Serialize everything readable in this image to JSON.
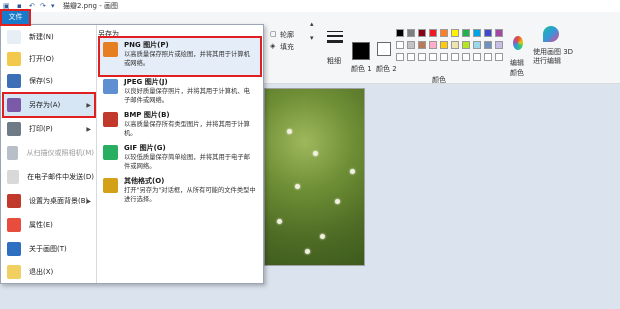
{
  "window": {
    "title": "猫瓣2.png - 画图"
  },
  "ribbon": {
    "file_tab": "文件",
    "outline_label": "轮廓",
    "fill_label": "填充",
    "thickness_label": "粗细",
    "color1_label": "颜色 1",
    "color2_label": "颜色 2",
    "edit_colors_label": "编辑颜色",
    "paint3d_label": "使用画图 3D 进行编辑",
    "colors_group_label": "颜色",
    "palette_row1": [
      "#000000",
      "#7f7f7f",
      "#880015",
      "#ed1c24",
      "#ff7f27",
      "#fff200",
      "#22b14c",
      "#00a2e8",
      "#3f48cc",
      "#a349a4"
    ],
    "palette_row2": [
      "#ffffff",
      "#c3c3c3",
      "#b97a57",
      "#ffaec9",
      "#ffc90e",
      "#efe4b0",
      "#b5e61d",
      "#99d9ea",
      "#7092be",
      "#c8bfe7"
    ],
    "palette_row3": [
      "#ffffff",
      "#ffffff",
      "#ffffff",
      "#ffffff",
      "#ffffff",
      "#ffffff",
      "#ffffff",
      "#ffffff",
      "#ffffff",
      "#ffffff"
    ]
  },
  "file_menu": {
    "items": [
      {
        "label": "新建(N)",
        "icon": "new-file-icon",
        "color": "#e8eef6"
      },
      {
        "label": "打开(O)",
        "icon": "open-folder-icon",
        "color": "#f2c94c"
      },
      {
        "label": "保存(S)",
        "icon": "save-disk-icon",
        "color": "#3c6fb5"
      },
      {
        "label": "另存为(A)",
        "icon": "save-as-icon",
        "color": "#7a5aa8",
        "has_submenu": true
      },
      {
        "label": "打印(P)",
        "icon": "printer-icon",
        "color": "#6f7a87",
        "has_submenu": true
      },
      {
        "label": "从扫描仪或照相机(M)",
        "icon": "scanner-icon",
        "color": "#b8bfc8",
        "disabled": true
      },
      {
        "label": "在电子邮件中发送(D)",
        "icon": "email-icon",
        "color": "#d9d9d9"
      },
      {
        "label": "设置为桌面背景(B)",
        "icon": "desktop-background-icon",
        "color": "#c0392b",
        "has_submenu": true
      },
      {
        "label": "属性(E)",
        "icon": "checkmark-icon",
        "color": "#e74c3c"
      },
      {
        "label": "关于画图(T)",
        "icon": "info-icon",
        "color": "#2d6fc0"
      },
      {
        "label": "退出(X)",
        "icon": "exit-icon",
        "color": "#f0d060"
      }
    ],
    "save_as": {
      "heading": "另存为",
      "options": [
        {
          "title": "PNG 图片(P)",
          "desc": "以高质量保存照片或绘图，并将其用于计算机或网络。",
          "icon": "png-image-icon",
          "color": "#e67e22"
        },
        {
          "title": "JPEG 图片(J)",
          "desc": "以良好质量保存照片，并将其用于计算机、电子邮件或网络。",
          "icon": "jpeg-image-icon",
          "color": "#5d8fd1"
        },
        {
          "title": "BMP 图片(B)",
          "desc": "以高质量保存所有类型图片，并将其用于计算机。",
          "icon": "bmp-image-icon",
          "color": "#c0392b"
        },
        {
          "title": "GIF 图片(G)",
          "desc": "以较低质量保存简单绘图，并将其用于电子邮件或网络。",
          "icon": "gif-image-icon",
          "color": "#27ae60"
        },
        {
          "title": "其他格式(O)",
          "desc": "打开\"另存为\"对话框，从所有可能的文件类型中进行选择。",
          "icon": "other-formats-icon",
          "color": "#d4a017"
        }
      ]
    }
  }
}
